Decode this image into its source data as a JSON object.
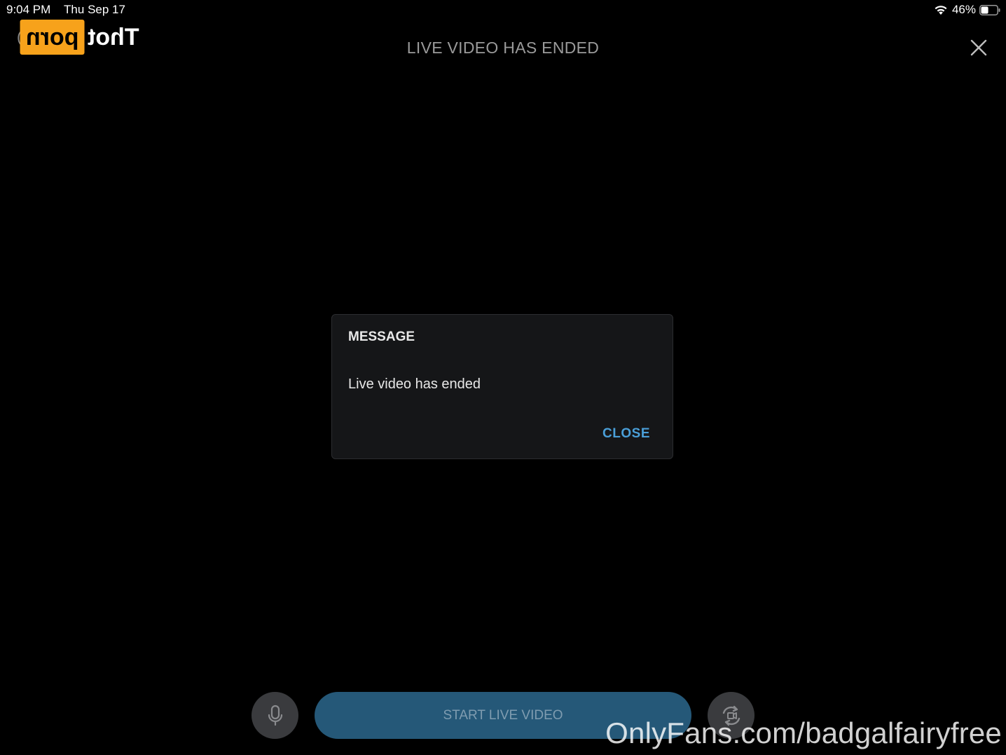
{
  "status_bar": {
    "time": "9:04 PM",
    "date": "Thu Sep 17",
    "battery_percent": "46%",
    "battery_level": 0.46,
    "wifi_icon": "wifi-icon"
  },
  "watermark_logo": {
    "paren": "(",
    "box_text": "porn",
    "text": "Thot"
  },
  "header": {
    "title": "LIVE VIDEO HAS ENDED",
    "close_icon": "close-icon"
  },
  "dialog": {
    "title": "MESSAGE",
    "message": "Live video has ended",
    "close_label": "CLOSE"
  },
  "controls": {
    "mic_icon": "microphone-icon",
    "start_label": "START LIVE VIDEO",
    "flip_icon": "camera-flip-icon"
  },
  "watermark_text": "OnlyFans.com/badgalfairyfree",
  "colors": {
    "background": "#000000",
    "accent": "#4a9fd8",
    "start_button": "#255878",
    "logo_orange": "#f7a21b"
  }
}
